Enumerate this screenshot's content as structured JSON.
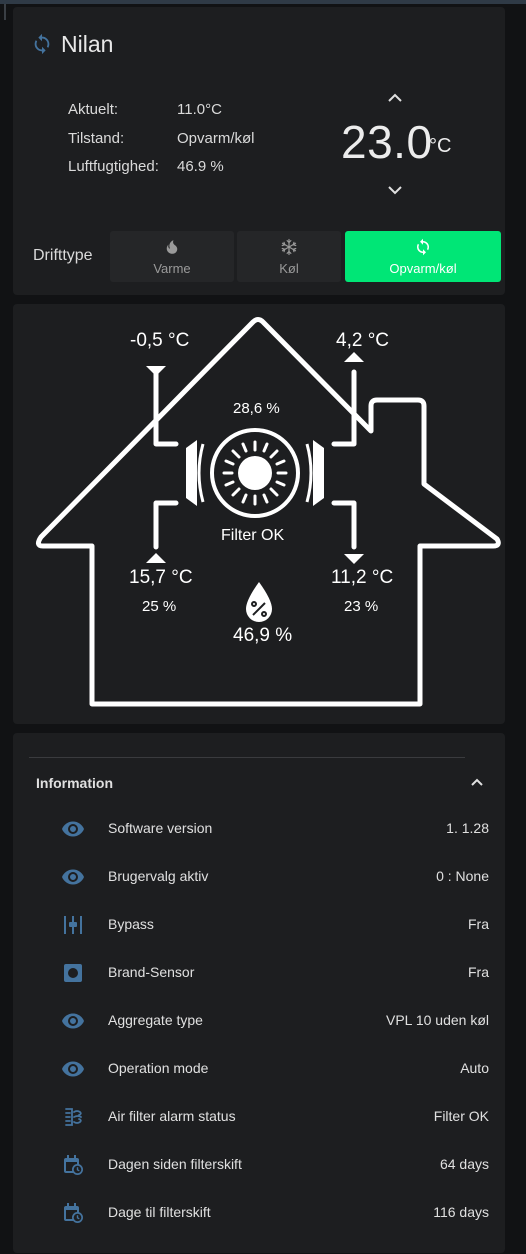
{
  "device": {
    "name": "Nilan",
    "icon": "sync-icon"
  },
  "thermostat": {
    "attributes": [
      {
        "label": "Aktuelt:",
        "value": "11.0°C"
      },
      {
        "label": "Tilstand:",
        "value": "Opvarm/køl"
      },
      {
        "label": "Luftfugtighed:",
        "value": "46.9 %"
      }
    ],
    "target": "23.0",
    "unit": "°C"
  },
  "modes": {
    "label": "Drifttype",
    "options": [
      {
        "label": "Varme",
        "icon": "fire-icon",
        "active": false
      },
      {
        "label": "Køl",
        "icon": "snowflake-icon",
        "active": false
      },
      {
        "label": "Opvarm/køl",
        "icon": "sync-icon",
        "active": true
      }
    ],
    "active_color": "#00e676"
  },
  "diagram": {
    "outdoor_temp": "-0,5 °C",
    "supply_temp": "4,2 °C",
    "fan_speed": "28,6 %",
    "filter_status": "Filter OK",
    "extract_temp": "15,7 °C",
    "extract_humidity": "25 %",
    "exhaust_temp": "11,2 °C",
    "exhaust_humidity": "23 %",
    "humidity": "46,9 %"
  },
  "info": {
    "title": "Information",
    "rows": [
      {
        "name": "Software version",
        "value": "1. 1.28",
        "icon": "eye-icon"
      },
      {
        "name": "Brugervalg aktiv",
        "value": "0 : None",
        "icon": "eye-icon"
      },
      {
        "name": "Bypass",
        "value": "Fra",
        "icon": "valve-icon"
      },
      {
        "name": "Brand-Sensor",
        "value": "Fra",
        "icon": "sensor-icon"
      },
      {
        "name": "Aggregate type",
        "value": "VPL 10 uden køl",
        "icon": "eye-icon"
      },
      {
        "name": "Operation mode",
        "value": "Auto",
        "icon": "eye-icon"
      },
      {
        "name": "Air filter alarm status",
        "value": "Filter OK",
        "icon": "air-filter-icon"
      },
      {
        "name": "Dagen siden filterskift",
        "value": "64 days",
        "icon": "calendar-clock-icon"
      },
      {
        "name": "Dage til filterskift",
        "value": "116 days",
        "icon": "calendar-clock-icon"
      }
    ]
  },
  "colors": {
    "icon": "#44739e",
    "card": "#1d1e20",
    "background": "#111214"
  }
}
